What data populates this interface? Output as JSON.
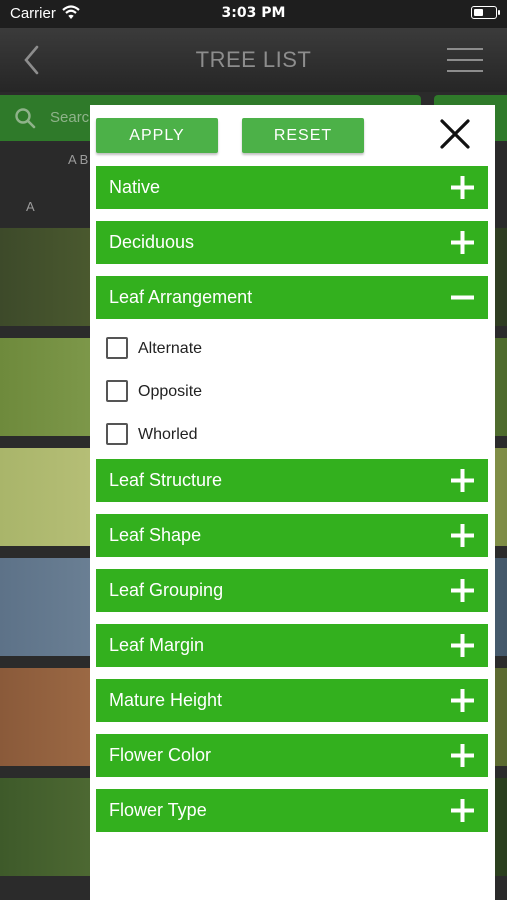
{
  "status_bar": {
    "carrier": "Carrier",
    "time": "3:03 PM"
  },
  "nav": {
    "title": "TREE LIST"
  },
  "background": {
    "search_placeholder": "Search",
    "alpha_row_1": "A B",
    "alpha_row_2": "A"
  },
  "filter_panel": {
    "apply_label": "APPLY",
    "reset_label": "RESET",
    "sections": [
      {
        "label": "Native",
        "expanded": false
      },
      {
        "label": "Deciduous",
        "expanded": false
      },
      {
        "label": "Leaf Arrangement",
        "expanded": true,
        "options": [
          {
            "label": "Alternate",
            "checked": false
          },
          {
            "label": "Opposite",
            "checked": false
          },
          {
            "label": "Whorled",
            "checked": false
          }
        ]
      },
      {
        "label": "Leaf Structure",
        "expanded": false
      },
      {
        "label": "Leaf Shape",
        "expanded": false
      },
      {
        "label": "Leaf Grouping",
        "expanded": false
      },
      {
        "label": "Leaf Margin",
        "expanded": false
      },
      {
        "label": "Mature Height",
        "expanded": false
      },
      {
        "label": "Flower Color",
        "expanded": false
      },
      {
        "label": "Flower Type",
        "expanded": false
      }
    ]
  },
  "colors": {
    "section_green": "#33b01e",
    "button_green": "#4cb148",
    "nav_dark": "#2b2b2b"
  }
}
